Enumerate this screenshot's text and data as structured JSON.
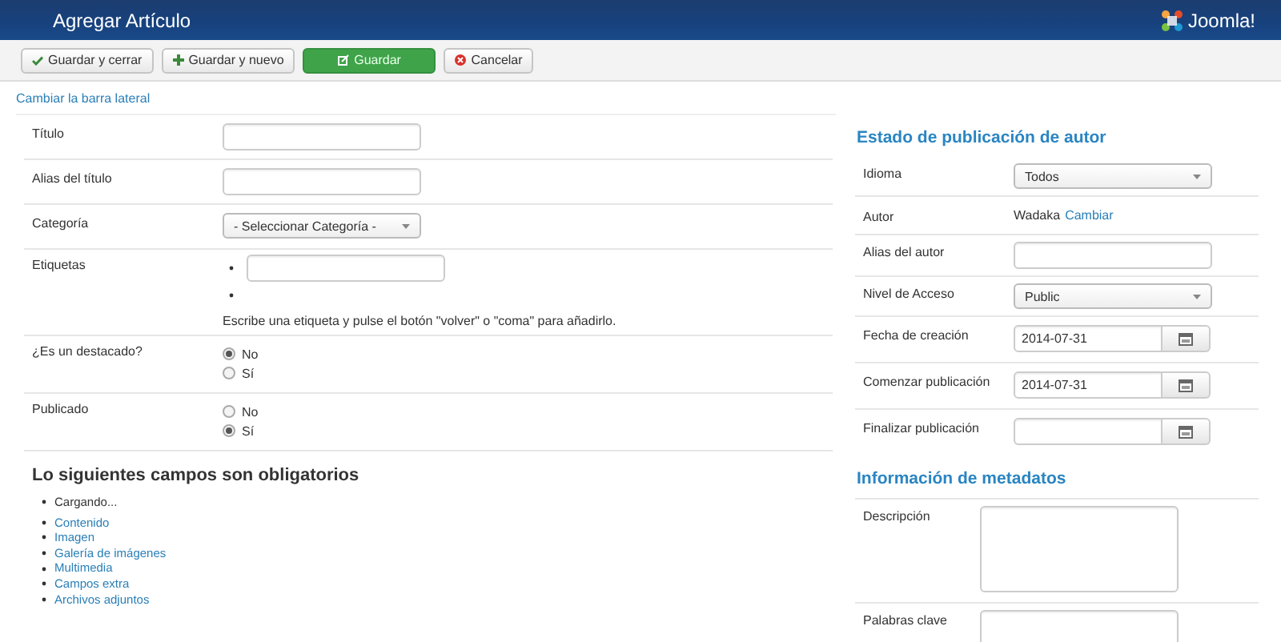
{
  "header": {
    "title": "Agregar Artículo",
    "logo": "Joomla!"
  },
  "toolbar": [
    {
      "label": "Guardar y cerrar",
      "kind": "check"
    },
    {
      "label": "Guardar y nuevo",
      "kind": "plus"
    },
    {
      "label": "Guardar",
      "kind": "primary"
    },
    {
      "label": "Cancelar",
      "kind": "cancel"
    }
  ],
  "sidebar_toggle": "Cambiar la barra lateral",
  "fields": [
    {
      "kind": "text",
      "label": "Título"
    },
    {
      "kind": "text",
      "label": "Alias del título"
    },
    {
      "kind": "select",
      "label": "Categoría",
      "value": "- Seleccionar Categoría -"
    },
    {
      "kind": "tags",
      "label": "Etiquetas",
      "hint": "Escribe una etiqueta y pulse el botón \"volver\" o \"coma\" para añadirlo."
    },
    {
      "kind": "radio",
      "label": "¿Es un destacado?",
      "options": [
        {
          "label": "No",
          "selected": true
        },
        {
          "label": "Sí",
          "selected": false
        }
      ]
    },
    {
      "kind": "radio",
      "label": "Publicado",
      "options": [
        {
          "label": "No",
          "selected": false
        },
        {
          "label": "Sí",
          "selected": true
        }
      ]
    }
  ],
  "required": {
    "title": "Lo siguientes campos son obligatorios",
    "loading": "Cargando...",
    "links": [
      "Contenido",
      "Imagen",
      "Galería de imágenes",
      "Multimedia",
      "Campos extra",
      "Archivos adjuntos"
    ]
  },
  "publishing": {
    "title": "Estado de publicación de autor",
    "fields": [
      {
        "kind": "select",
        "label": "Idioma",
        "value": "Todos"
      },
      {
        "kind": "author",
        "label": "Autor",
        "value": "Wadaka",
        "link": "Cambiar"
      },
      {
        "kind": "text",
        "label": "Alias del autor"
      },
      {
        "kind": "select",
        "label": "Nivel de Acceso",
        "value": "Public"
      },
      {
        "kind": "date",
        "label": "Fecha de creación",
        "value": "2014-07-31"
      },
      {
        "kind": "date",
        "label": "Comenzar publicación",
        "value": "2014-07-31"
      },
      {
        "kind": "date",
        "label": "Finalizar publicación"
      }
    ]
  },
  "metadata": {
    "title": "Información de metadatos",
    "fields": [
      {
        "kind": "textarea",
        "label": "Descripción"
      },
      {
        "kind": "textarea",
        "label": "Palabras clave"
      }
    ]
  }
}
